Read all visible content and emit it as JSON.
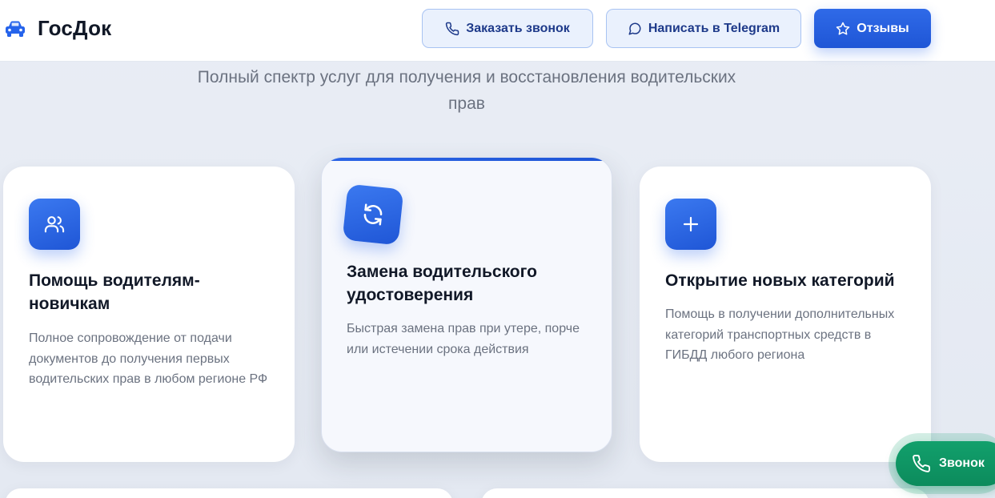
{
  "header": {
    "brand": "ГосДок",
    "logo_icon": "car-icon",
    "buttons": {
      "call_label": "Заказать звонок",
      "telegram_label": "Написать в Telegram",
      "reviews_label": "Отзывы"
    }
  },
  "section": {
    "subtitle": "Полный спектр услуг для получения и восстановления водительских прав"
  },
  "cards": [
    {
      "icon": "users-icon",
      "title": "Помощь водителям-новичкам",
      "description": "Полное сопровождение от подачи документов до получения первых водительских прав в любом регионе РФ"
    },
    {
      "icon": "refresh-icon",
      "title": "Замена водительского удостоверения",
      "description": "Быстрая замена прав при утере, порче или истечении срока действия"
    },
    {
      "icon": "plus-icon",
      "title": "Открытие новых категорий",
      "description": "Помощь в получении дополнительных категорий транспортных средств в ГИБДД любого региона"
    }
  ],
  "floating_button": {
    "label": "Звонок",
    "icon": "phone-icon"
  },
  "colors": {
    "accent": "#2563eb",
    "fab": "#10a36e",
    "background": "#e7ecf4"
  }
}
